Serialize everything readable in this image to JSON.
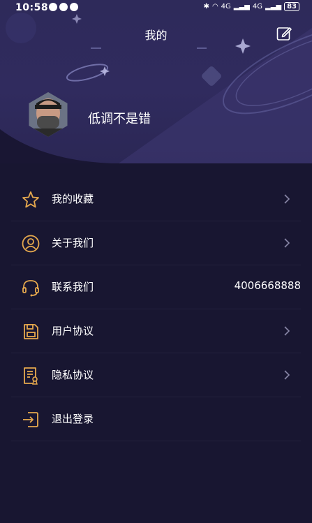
{
  "status_bar": {
    "time": "10:58",
    "battery": "83",
    "network_1": "4G",
    "network_2": "4G"
  },
  "header": {
    "title": "我的"
  },
  "profile": {
    "username": "低调不是错"
  },
  "menu": {
    "items": [
      {
        "label": "我的收藏",
        "icon": "star-icon",
        "has_chevron": true
      },
      {
        "label": "关于我们",
        "icon": "user-circle-icon",
        "has_chevron": true
      },
      {
        "label": "联系我们",
        "icon": "headset-icon",
        "value": "4006668888"
      },
      {
        "label": "用户协议",
        "icon": "save-disk-icon",
        "has_chevron": true
      },
      {
        "label": "隐私协议",
        "icon": "document-stamp-icon",
        "has_chevron": true
      },
      {
        "label": "退出登录",
        "icon": "logout-icon",
        "has_chevron": false
      }
    ]
  },
  "colors": {
    "background": "#181631",
    "hero": "#2e2a5a",
    "icon_accent": "#e6a94e",
    "divider": "#23213d"
  }
}
